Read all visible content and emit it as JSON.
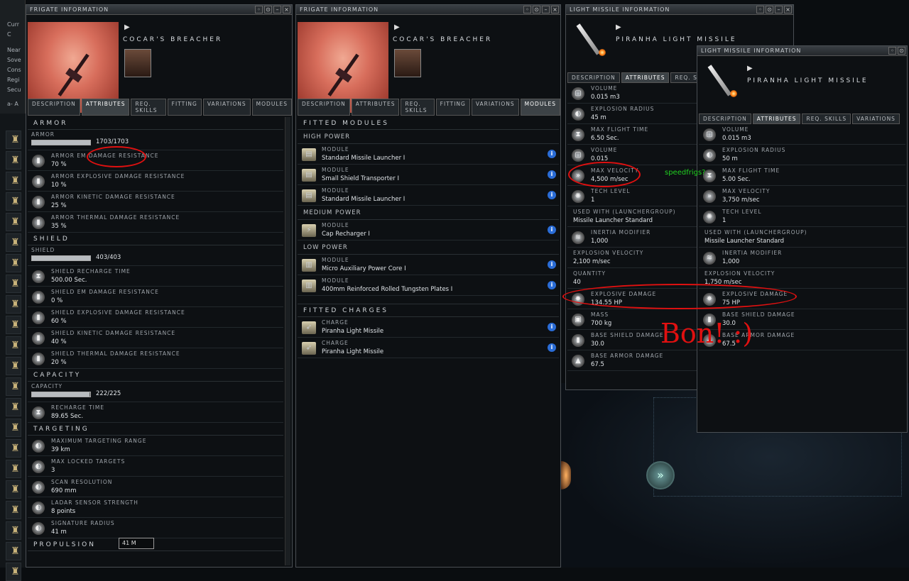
{
  "overview": {
    "items": [
      "Curr",
      "C",
      "Near",
      "Sove",
      "Cons",
      "Regi",
      "Secu",
      "a- A"
    ]
  },
  "win1": {
    "title": "FRIGATE INFORMATION",
    "name": "COCAR'S BREACHER",
    "tabs": [
      "DESCRIPTION",
      "ATTRIBUTES",
      "REQ. SKILLS",
      "FITTING",
      "VARIATIONS",
      "MODULES"
    ],
    "armor_section": "ARMOR",
    "armor_label": "ARMOR",
    "armor_value": "1703/1703",
    "armor_fill": 1.0,
    "armor_attrs": [
      {
        "label": "ARMOR EM DAMAGE RESISTANCE",
        "value": "70 %"
      },
      {
        "label": "ARMOR EXPLOSIVE DAMAGE RESISTANCE",
        "value": "10 %"
      },
      {
        "label": "ARMOR KINETIC DAMAGE RESISTANCE",
        "value": "25 %"
      },
      {
        "label": "ARMOR THERMAL DAMAGE RESISTANCE",
        "value": "35 %"
      }
    ],
    "shield_section": "SHIELD",
    "shield_label": "SHIELD",
    "shield_value": "403/403",
    "shield_fill": 1.0,
    "shield_attrs": [
      {
        "label": "SHIELD RECHARGE TIME",
        "value": "500.00 Sec."
      },
      {
        "label": "SHIELD EM DAMAGE RESISTANCE",
        "value": "0 %"
      },
      {
        "label": "SHIELD EXPLOSIVE DAMAGE RESISTANCE",
        "value": "60 %"
      },
      {
        "label": "SHIELD KINETIC DAMAGE RESISTANCE",
        "value": "40 %"
      },
      {
        "label": "SHIELD THERMAL DAMAGE RESISTANCE",
        "value": "20 %"
      }
    ],
    "capacity_section": "CAPACITY",
    "capacity_label": "CAPACITY",
    "capacity_value": "222/225",
    "capacity_fill": 0.987,
    "recharge": {
      "label": "RECHARGE TIME",
      "value": "89.65 Sec."
    },
    "targeting_section": "TARGETING",
    "targeting_attrs": [
      {
        "label": "MAXIMUM TARGETING RANGE",
        "value": "39 km"
      },
      {
        "label": "MAX LOCKED TARGETS",
        "value": "3"
      },
      {
        "label": "SCAN RESOLUTION",
        "value": "690 mm"
      },
      {
        "label": "LADAR SENSOR STRENGTH",
        "value": "8 points"
      },
      {
        "label": "SIGNATURE RADIUS",
        "value": "41 m"
      }
    ],
    "propulsion_section": "PROPULSION",
    "tooltip": "41 M"
  },
  "win2": {
    "title": "FRIGATE INFORMATION",
    "name": "COCAR'S BREACHER",
    "tabs": [
      "DESCRIPTION",
      "ATTRIBUTES",
      "REQ. SKILLS",
      "FITTING",
      "VARIATIONS",
      "MODULES"
    ],
    "fitted_modules": "FITTED MODULES",
    "high_power": "HIGH POWER",
    "medium_power": "MEDIUM POWER",
    "low_power": "LOW POWER",
    "fitted_charges": "FITTED CHARGES",
    "high": [
      {
        "label": "MODULE",
        "value": "Standard Missile Launcher I"
      },
      {
        "label": "MODULE",
        "value": "Small Shield Transporter I"
      },
      {
        "label": "MODULE",
        "value": "Standard Missile Launcher I"
      }
    ],
    "medium": [
      {
        "label": "MODULE",
        "value": "Cap Recharger I"
      }
    ],
    "low": [
      {
        "label": "MODULE",
        "value": "Micro Auxiliary Power Core I"
      },
      {
        "label": "MODULE",
        "value": "400mm Reinforced Rolled Tungsten Plates I"
      }
    ],
    "charges": [
      {
        "label": "CHARGE",
        "value": "Piranha Light Missile"
      },
      {
        "label": "CHARGE",
        "value": "Piranha Light Missile"
      }
    ]
  },
  "win3": {
    "title": "LIGHT MISSILE INFORMATION",
    "name": "PIRANHA LIGHT MISSILE",
    "tabs": [
      "DESCRIPTION",
      "ATTRIBUTES",
      "REQ. SK"
    ],
    "attrs": [
      {
        "label": "VOLUME",
        "value": "0.015 m3",
        "icon": "cube"
      },
      {
        "label": "EXPLOSION RADIUS",
        "value": "45 m",
        "icon": "radius"
      },
      {
        "label": "MAX FLIGHT TIME",
        "value": "6.50 Sec.",
        "icon": "hourglass"
      },
      {
        "label": "VOLUME",
        "value": "0.015",
        "icon": "cube"
      },
      {
        "label": "MAX VELOCITY",
        "value": "4,500 m/sec",
        "icon": "velocity"
      },
      {
        "label": "TECH LEVEL",
        "value": "1",
        "icon": "tech"
      }
    ],
    "plain": [
      {
        "label": "USED WITH (LAUNCHERGROUP)",
        "value": "Missile Launcher Standard"
      }
    ],
    "attrs2": [
      {
        "label": "INERTIA MODIFIER",
        "value": "1,000",
        "icon": "wing"
      }
    ],
    "plain2": [
      {
        "label": "EXPLOSION VELOCITY",
        "value": "2,100 m/sec"
      },
      {
        "label": "QUANTITY",
        "value": "40"
      }
    ],
    "attrs3": [
      {
        "label": "EXPLOSIVE DAMAGE",
        "value": "134.55 HP",
        "icon": "explosive"
      },
      {
        "label": "MASS",
        "value": "700 kg",
        "icon": "mass"
      },
      {
        "label": "BASE SHIELD DAMAGE",
        "value": "30.0",
        "icon": "shield"
      },
      {
        "label": "BASE ARMOR DAMAGE",
        "value": "67.5",
        "icon": "armor"
      }
    ]
  },
  "win4": {
    "title": "LIGHT MISSILE INFORMATION",
    "name": "PIRANHA LIGHT MISSILE",
    "tabs": [
      "DESCRIPTION",
      "ATTRIBUTES",
      "REQ. SKILLS",
      "VARIATIONS"
    ],
    "attrs": [
      {
        "label": "VOLUME",
        "value": "0.015 m3",
        "icon": "cube"
      },
      {
        "label": "EXPLOSION RADIUS",
        "value": "50 m",
        "icon": "radius"
      },
      {
        "label": "MAX FLIGHT TIME",
        "value": "5.00 Sec.",
        "icon": "hourglass"
      },
      {
        "label": "MAX VELOCITY",
        "value": "3,750 m/sec",
        "icon": "velocity"
      },
      {
        "label": "TECH LEVEL",
        "value": "1",
        "icon": "tech"
      }
    ],
    "plain": [
      {
        "label": "USED WITH (LAUNCHERGROUP)",
        "value": "Missile Launcher Standard"
      }
    ],
    "attrs2": [
      {
        "label": "INERTIA MODIFIER",
        "value": "1,000",
        "icon": "wing"
      }
    ],
    "plain2": [
      {
        "label": "EXPLOSION VELOCITY",
        "value": "1,750 m/sec"
      }
    ],
    "attrs3": [
      {
        "label": "EXPLOSIVE DAMAGE",
        "value": "75 HP",
        "icon": "explosive"
      },
      {
        "label": "BASE SHIELD DAMAGE",
        "value": "30.0",
        "icon": "shield"
      },
      {
        "label": "BASE ARMOR DAMAGE",
        "value": "67.5",
        "icon": "armor"
      }
    ]
  },
  "annotations": {
    "speed_note": "speedfrigs?",
    "bonus_note": "Bon! :)",
    "color": "#e01010"
  }
}
